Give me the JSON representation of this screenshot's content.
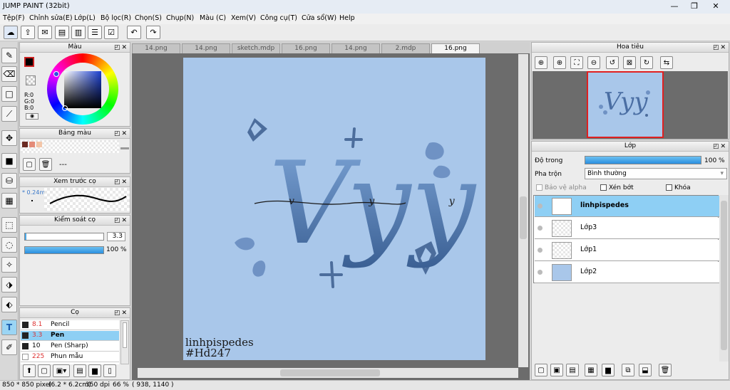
{
  "window": {
    "title": "JUMP PAINT (32bit)"
  },
  "menu": [
    "Tệp(F)",
    "Chỉnh sửa(E)",
    "Lớp(L)",
    "Bộ lọc(R)",
    "Chọn(S)",
    "Chụp(N)",
    "Màu (C)",
    "Xem(V)",
    "Công cụ(T)",
    "Cửa sổ(W)",
    "Help"
  ],
  "tabs": [
    "14.png",
    "14.png",
    "sketch.mdp",
    "16.png",
    "14.png",
    "2.mdp",
    "16.png"
  ],
  "panels": {
    "color": {
      "title": "Màu",
      "r": "R:0",
      "g": "G:0",
      "b": "B:0"
    },
    "palette": {
      "title": "Bảng màu",
      "info": "---",
      "swatches": [
        "#6b2a22",
        "#e48b78",
        "#f3c6a8"
      ]
    },
    "brush_preview": {
      "title": "Xem trước cọ",
      "size": "* 0.24m"
    },
    "brush_control": {
      "title": "Kiểm soát cọ",
      "size_value": "3.3",
      "opacity_value": "100 %"
    },
    "brushes": {
      "title": "Cọ",
      "items": [
        {
          "size": "8.1",
          "name": "Pencil"
        },
        {
          "size": "3.3",
          "name": "Pen"
        },
        {
          "size": "10",
          "name": "Pen (Sharp)"
        },
        {
          "size": "225",
          "name": "Phun mẫu"
        }
      ]
    },
    "navigator": {
      "title": "Hoa tiêu"
    },
    "layers": {
      "title": "Lớp",
      "opacity_label": "Độ trong",
      "opacity_value": "100 %",
      "opacity_fraction": 1.0,
      "blend_label": "Pha trộn",
      "blend_value": "Bình thường",
      "protect_alpha": "Bảo vệ alpha",
      "clipping": "Xén bớt",
      "lock": "Khóa",
      "items": [
        "linhpispedes",
        "Lớp3",
        "Lớp1",
        "Lớp2"
      ]
    }
  },
  "artwork": {
    "main_text": "Vyy",
    "sub_text": "v y y",
    "credit_line1": "linhpispedes",
    "credit_line2": "#Hd247"
  },
  "status": {
    "size": "850 * 850 pixel",
    "cm": "(6.2 * 6.2cm)",
    "dpi": "350 dpi",
    "zoom": "66 %",
    "coords": "( 938, 1140 )"
  }
}
